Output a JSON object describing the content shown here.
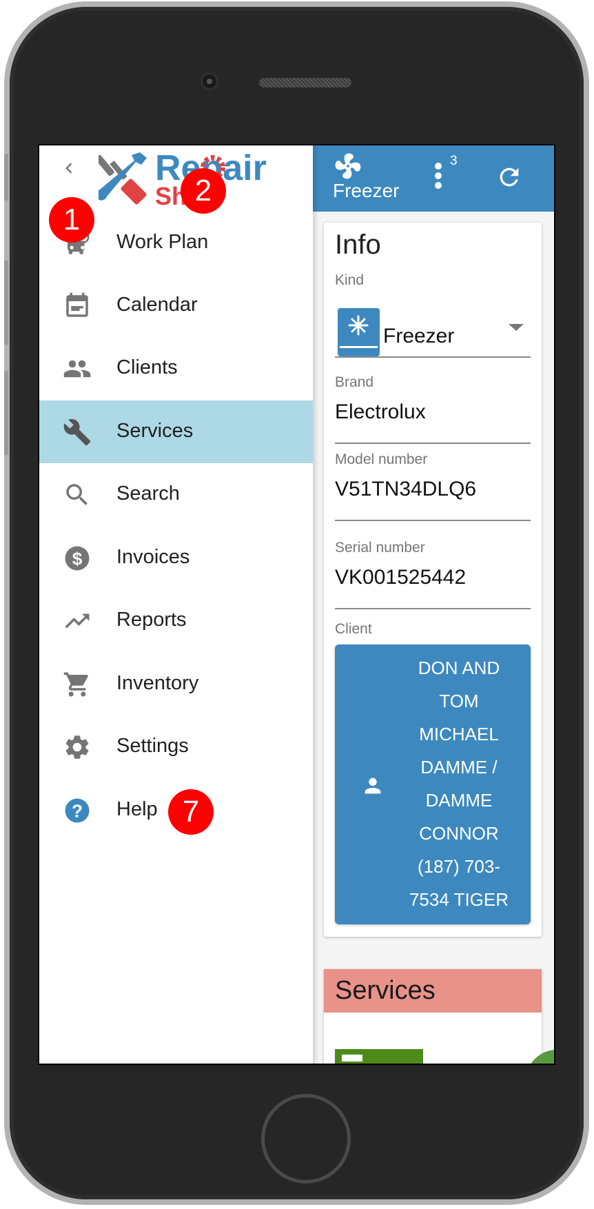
{
  "app": {
    "logo_text_main": "Repair",
    "logo_text_sub": "Sh"
  },
  "header": {
    "title": "Freezer",
    "icon": "fan-icon",
    "menu_badge": "3",
    "refresh_icon": "refresh-icon"
  },
  "drawer": {
    "back_icon": "chevron-left-icon",
    "items": [
      {
        "label": "Work Plan",
        "icon": "bus-schedule-icon",
        "active": false
      },
      {
        "label": "Calendar",
        "icon": "calendar-icon",
        "active": false
      },
      {
        "label": "Clients",
        "icon": "people-icon",
        "active": false
      },
      {
        "label": "Services",
        "icon": "wrench-icon",
        "active": true
      },
      {
        "label": "Search",
        "icon": "search-icon",
        "active": false
      },
      {
        "label": "Invoices",
        "icon": "dollar-circle-icon",
        "active": false
      },
      {
        "label": "Reports",
        "icon": "trending-up-icon",
        "active": false
      },
      {
        "label": "Inventory",
        "icon": "cart-icon",
        "active": false
      },
      {
        "label": "Settings",
        "icon": "gear-icon",
        "active": false
      },
      {
        "label": "Help",
        "icon": "help-circle-icon",
        "active": false
      }
    ]
  },
  "annotations": {
    "step_1": "1",
    "step_2": "2",
    "step_7": "7"
  },
  "info": {
    "title": "Info",
    "kind_label": "Kind",
    "kind_value": "Freezer",
    "brand_label": "Brand",
    "brand_value": "Electrolux",
    "model_label": "Model number",
    "model_value": "V51TN34DLQ6",
    "serial_label": "Serial number",
    "serial_value": "VK001525442",
    "client_label": "Client",
    "client_lines": [
      "DON AND",
      "TOM",
      "MICHAEL",
      "DAMME /",
      "DAMME",
      "CONNOR",
      "(187) 703-",
      "7534 TIGER"
    ]
  },
  "services": {
    "title": "Services"
  },
  "colors": {
    "primary": "#3d89bf",
    "active_nav": "#add8e6",
    "services_header": "#e8928a",
    "badge": "#ff0000",
    "green_action": "#4e8a1a"
  }
}
